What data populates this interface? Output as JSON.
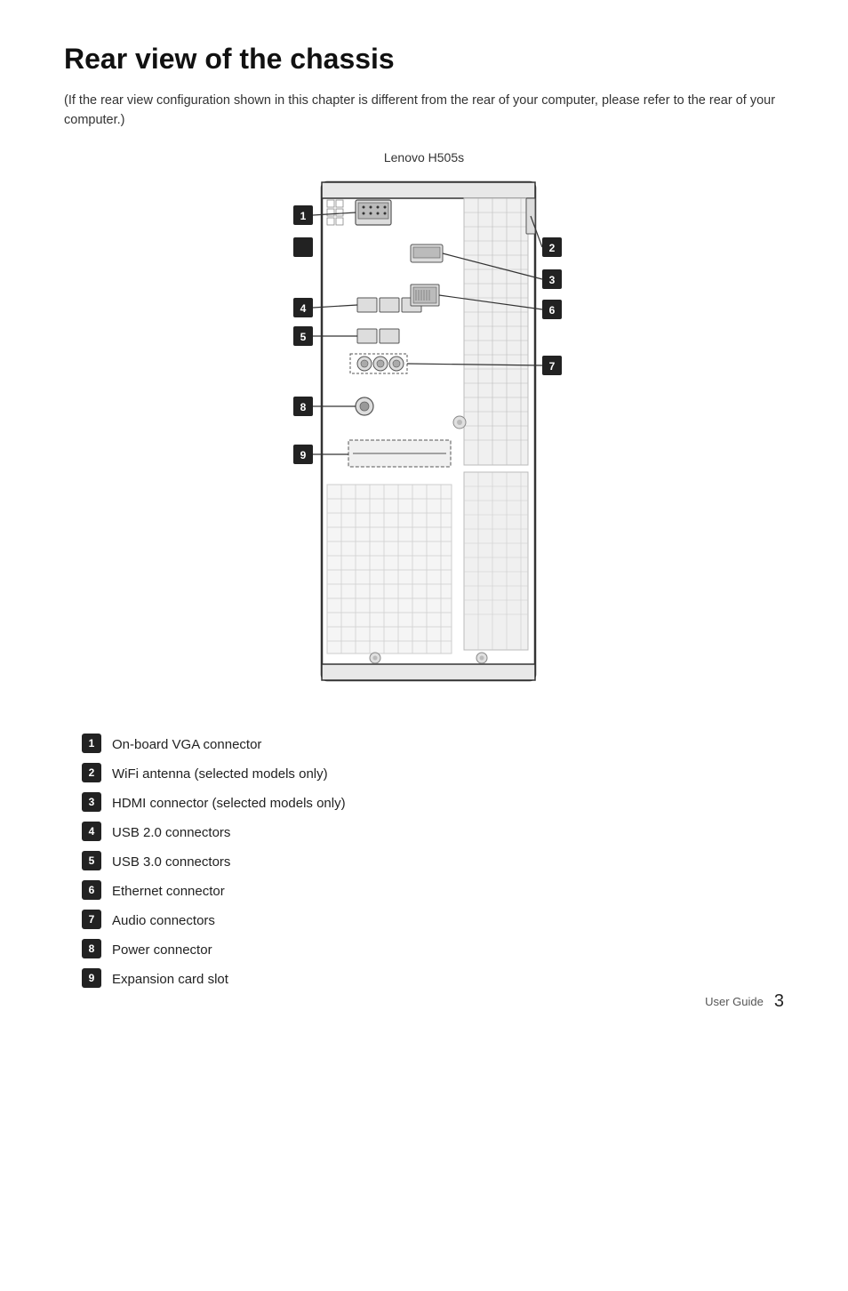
{
  "page": {
    "title": "Rear view of the chassis",
    "intro": "(If the rear view configuration shown in this chapter is different from the rear of your computer, please refer to the rear of your computer.)",
    "diagram_title": "Lenovo H505s",
    "footer_label": "User Guide",
    "footer_page": "3"
  },
  "legend": [
    {
      "num": "1",
      "text": "On-board VGA connector"
    },
    {
      "num": "2",
      "text": "WiFi antenna (selected models only)"
    },
    {
      "num": "3",
      "text": "HDMI connector (selected models only)"
    },
    {
      "num": "4",
      "text": "USB 2.0 connectors"
    },
    {
      "num": "5",
      "text": "USB 3.0 connectors"
    },
    {
      "num": "6",
      "text": "Ethernet connector"
    },
    {
      "num": "7",
      "text": "Audio connectors"
    },
    {
      "num": "8",
      "text": "Power connector"
    },
    {
      "num": "9",
      "text": "Expansion card slot"
    }
  ]
}
